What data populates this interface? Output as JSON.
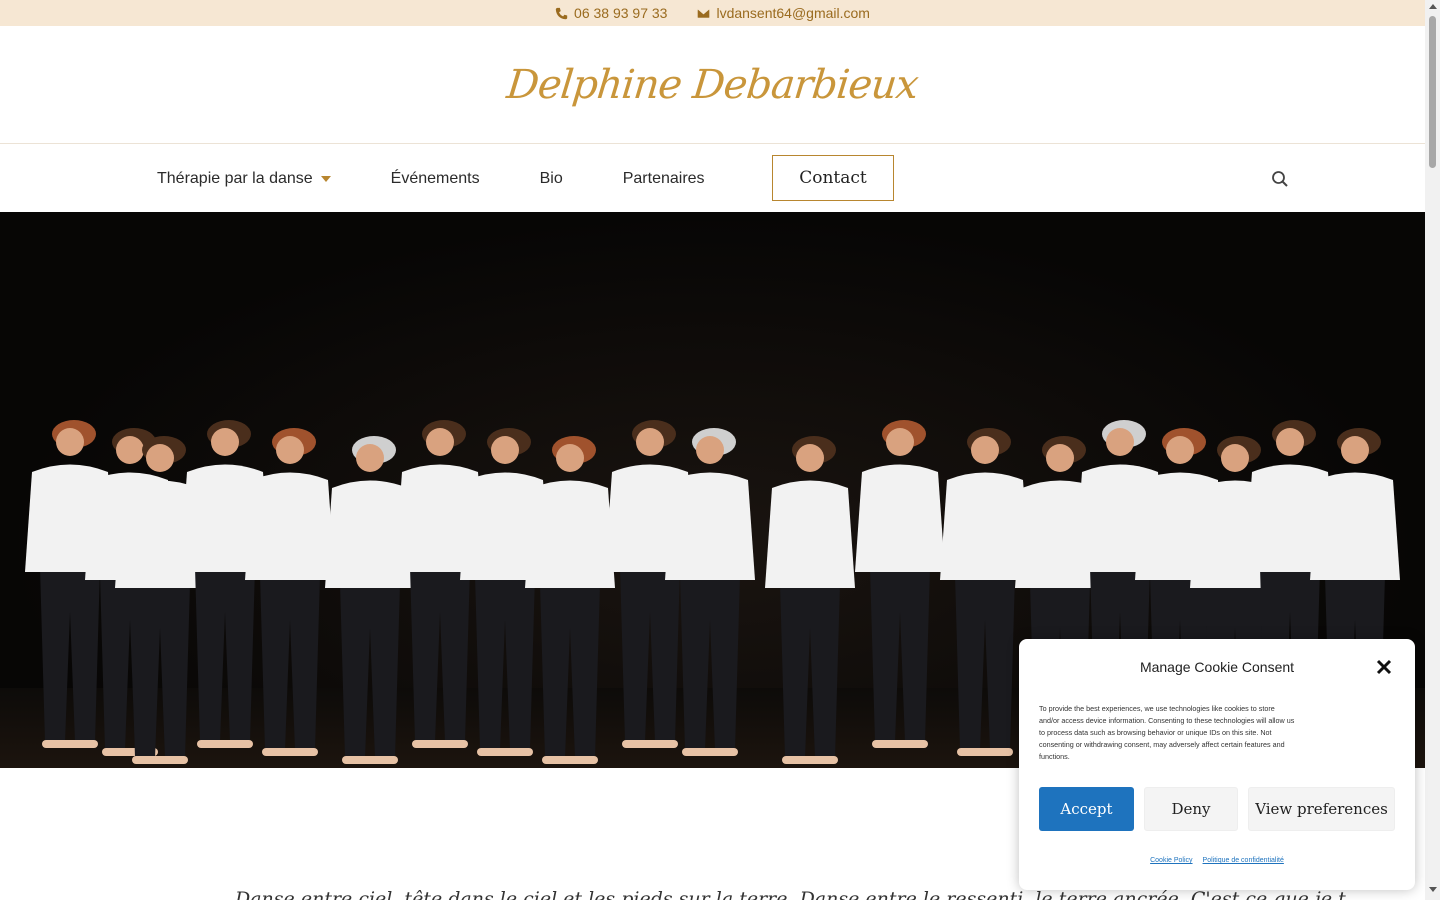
{
  "topbar": {
    "phone": "06 38 93 97 33",
    "email": "lvdansent64@gmail.com",
    "icons": [
      "phone-icon",
      "envelope-icon"
    ]
  },
  "brand": {
    "logo_text": "Delphine Debarbieux"
  },
  "nav": {
    "items": [
      {
        "label": "Thérapie par la danse",
        "has_dropdown": true
      },
      {
        "label": "Événements"
      },
      {
        "label": "Bio"
      },
      {
        "label": "Partenaires"
      }
    ],
    "contact_label": "Contact",
    "search_icon": "search-icon"
  },
  "intro": {
    "text": "Danse entre ciel, tête dans le ciel et les pieds sur la terre. Danse entre le ressenti, le terre ancrée. C'est ce que je t"
  },
  "cookie": {
    "title": "Manage Cookie Consent",
    "message": "To provide the best experiences, we use technologies like cookies to store and/or access device information. Consenting to these technologies will allow us to process data such as browsing behavior or unique IDs on this site. Not consenting or withdrawing consent, may adversely affect certain features and functions.",
    "accept_label": "Accept",
    "deny_label": "Deny",
    "prefs_label": "View preferences",
    "cookie_policy_label": "Cookie Policy",
    "privacy_label": "Politique de confidentialité"
  },
  "colors": {
    "topbar_bg": "#f6e7d3",
    "accent_gold": "#c9963b",
    "accept_blue": "#1e73be"
  }
}
